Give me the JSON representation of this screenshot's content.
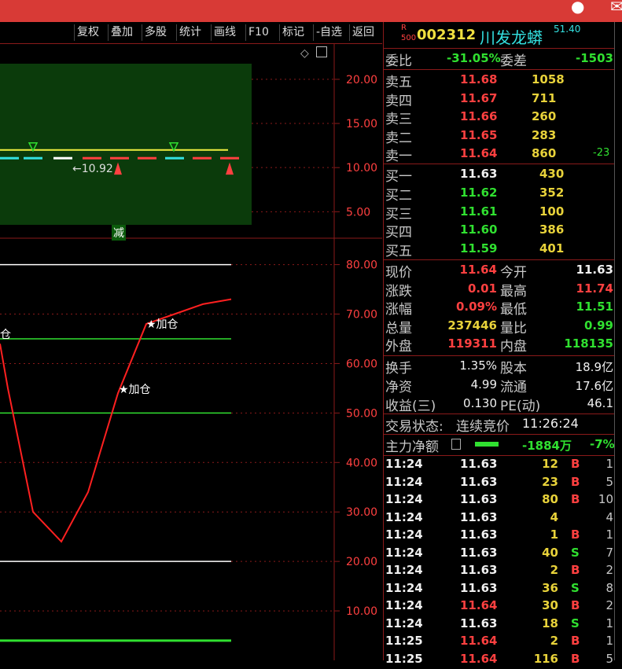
{
  "toolbar": {
    "buttons": [
      "复权",
      "叠加",
      "多股",
      "统计",
      "画线",
      "F10",
      "标记",
      "-自选",
      "返回"
    ]
  },
  "upper_chart": {
    "y_ticks": [
      "20.00",
      "15.00",
      "10.00",
      "5.00"
    ],
    "last_price_label": "10.92",
    "reduce_label": "减"
  },
  "lower_chart": {
    "y_ticks": [
      "80.00",
      "70.00",
      "60.00",
      "50.00",
      "40.00",
      "30.00",
      "20.00",
      "10.00"
    ],
    "add_labels": [
      "★加仓",
      "★加仓",
      "仓"
    ]
  },
  "chart_data": [
    {
      "type": "line",
      "title": "",
      "ylim": [
        2,
        24
      ],
      "y_ticks": [
        20,
        15,
        10,
        5
      ],
      "series": [
        {
          "values": [
            12.0,
            12.0,
            12.0,
            12.0,
            12.0,
            12.0,
            12.0,
            12.0
          ]
        }
      ]
    },
    {
      "type": "line",
      "title": "",
      "ylim": [
        0,
        82
      ],
      "y_ticks": [
        80,
        70,
        60,
        50,
        40,
        30,
        20,
        10
      ],
      "hlines": [
        80,
        65,
        50,
        20,
        4
      ],
      "series": [
        {
          "values": [
            64,
            55,
            30,
            24,
            34,
            54,
            68,
            70,
            72,
            73
          ]
        }
      ]
    }
  ],
  "stock": {
    "badge_top": "R",
    "badge_bottom": "500",
    "code": "002312",
    "name": "川发龙蟒",
    "pct_tag": "51.40"
  },
  "order_ratio": {
    "label": "委比",
    "value": "-31.05%",
    "label2": "委差",
    "value2": "-1503"
  },
  "asks": [
    {
      "label": "卖五",
      "price": "11.68",
      "volume": "1058",
      "change": ""
    },
    {
      "label": "卖四",
      "price": "11.67",
      "volume": "711",
      "change": ""
    },
    {
      "label": "卖三",
      "price": "11.66",
      "volume": "260",
      "change": ""
    },
    {
      "label": "卖二",
      "price": "11.65",
      "volume": "283",
      "change": ""
    },
    {
      "label": "卖一",
      "price": "11.64",
      "volume": "860",
      "change": "-23"
    }
  ],
  "bids": [
    {
      "label": "买一",
      "price": "11.63",
      "volume": "430"
    },
    {
      "label": "买二",
      "price": "11.62",
      "volume": "352"
    },
    {
      "label": "买三",
      "price": "11.61",
      "volume": "100"
    },
    {
      "label": "买四",
      "price": "11.60",
      "volume": "386"
    },
    {
      "label": "买五",
      "price": "11.59",
      "volume": "401"
    }
  ],
  "quote": [
    {
      "l1": "现价",
      "v1": "11.64",
      "l2": "今开",
      "v2": "11.63"
    },
    {
      "l1": "涨跌",
      "v1": "0.01",
      "l2": "最高",
      "v2": "11.74"
    },
    {
      "l1": "涨幅",
      "v1": "0.09%",
      "l2": "最低",
      "v2": "11.51"
    },
    {
      "l1": "总量",
      "v1": "237446",
      "l2": "量比",
      "v2": "0.99"
    },
    {
      "l1": "外盘",
      "v1": "119311",
      "l2": "内盘",
      "v2": "118135"
    }
  ],
  "fundamentals": [
    {
      "l1": "换手",
      "v1": "1.35%",
      "l2": "股本",
      "v2": "18.9亿"
    },
    {
      "l1": "净资",
      "v1": "4.99",
      "l2": "流通",
      "v2": "17.6亿"
    },
    {
      "l1": "收益(三)",
      "v1": "0.130",
      "l2": "PE(动)",
      "v2": "46.1"
    }
  ],
  "status": {
    "label": "交易状态:",
    "value": "连续竞价",
    "time": "11:26:24"
  },
  "main_force": {
    "label": "主力净额",
    "value": "-1884万",
    "pct": "-7%"
  },
  "ticks": [
    {
      "time": "11:24",
      "price": "11.63",
      "vol": "12",
      "side": "B",
      "n": "1"
    },
    {
      "time": "11:24",
      "price": "11.63",
      "vol": "23",
      "side": "B",
      "n": "5"
    },
    {
      "time": "11:24",
      "price": "11.63",
      "vol": "80",
      "side": "B",
      "n": "10"
    },
    {
      "time": "11:24",
      "price": "11.63",
      "vol": "4",
      "side": "",
      "n": "4"
    },
    {
      "time": "11:24",
      "price": "11.63",
      "vol": "1",
      "side": "B",
      "n": "1"
    },
    {
      "time": "11:24",
      "price": "11.63",
      "vol": "40",
      "side": "S",
      "n": "7"
    },
    {
      "time": "11:24",
      "price": "11.63",
      "vol": "2",
      "side": "B",
      "n": "2"
    },
    {
      "time": "11:24",
      "price": "11.63",
      "vol": "36",
      "side": "S",
      "n": "8"
    },
    {
      "time": "11:24",
      "price": "11.64",
      "vol": "30",
      "side": "B",
      "n": "2"
    },
    {
      "time": "11:24",
      "price": "11.63",
      "vol": "18",
      "side": "S",
      "n": "1"
    },
    {
      "time": "11:25",
      "price": "11.64",
      "vol": "2",
      "side": "B",
      "n": "1"
    },
    {
      "time": "11:25",
      "price": "11.64",
      "vol": "116",
      "side": "B",
      "n": "5"
    }
  ],
  "colors": {
    "up": "#ff4040",
    "down": "#30e030",
    "neutral": "#f0f0f0",
    "volume": "#e8d23a",
    "border": "#8a1a1a"
  }
}
